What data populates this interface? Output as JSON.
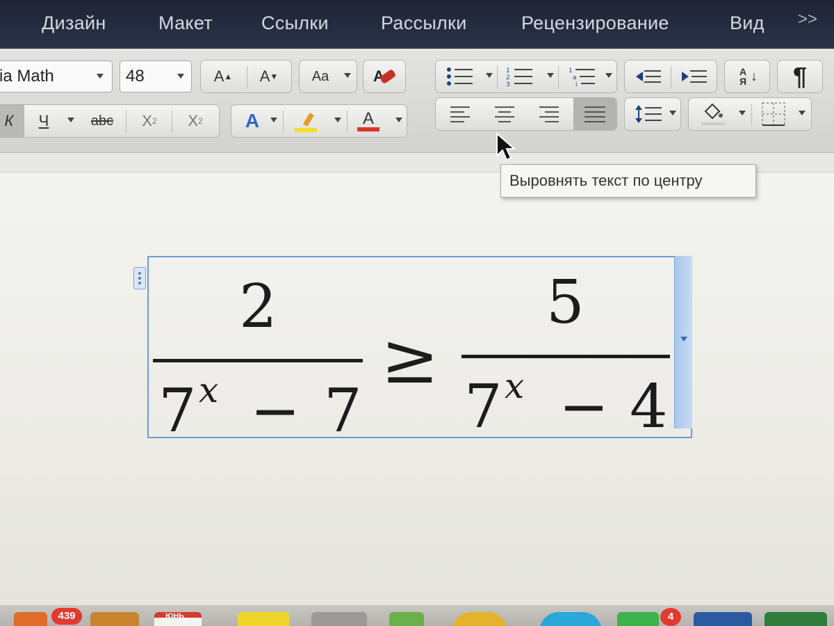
{
  "menu": {
    "items": [
      "Дизайн",
      "Макет",
      "Ссылки",
      "Рассылки",
      "Рецензирование",
      "Вид"
    ],
    "more": ">>"
  },
  "ribbon": {
    "font_name": "ia Math",
    "font_size": "48",
    "grow_font": "A",
    "shrink_font": "A",
    "change_case": "Aa",
    "clear_format": "A",
    "sort": "А Я",
    "pilcrow": "¶",
    "italic": "К",
    "underline": "Ч",
    "strikethrough": "abc",
    "subscript": "X",
    "subscript_mark": "2",
    "superscript": "X",
    "superscript_mark": "2",
    "text_effects": "A",
    "font_color": "A"
  },
  "tooltip": {
    "text": "Выровнять текст по центру"
  },
  "equation": {
    "left_numerator": "2",
    "left_base": "7",
    "left_exponent": "x",
    "left_minus": "−",
    "left_constant": "7",
    "operator": "≥",
    "right_numerator": "5",
    "right_base": "7",
    "right_exponent": "x",
    "right_minus": "−",
    "right_constant": "4"
  },
  "dock": {
    "mail_badge": "439",
    "calendar_label": "ЮНЬ",
    "notify_badge": "4"
  },
  "colors": {
    "menubar": "#1e2436",
    "selection_border": "#6e9ad2",
    "highlight_yellow": "#f0dd2a",
    "font_color_red": "#d8352b",
    "badge_red": "#e23a2e"
  }
}
